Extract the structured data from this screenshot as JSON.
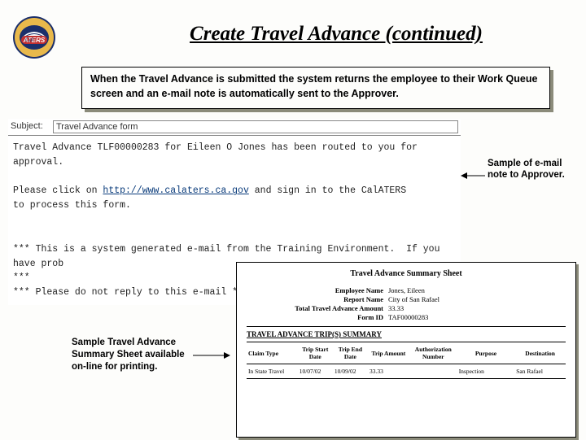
{
  "title": "Create Travel Advance (continued)",
  "banner": "When the Travel Advance is submitted the system returns the employee to their Work Queue screen and an e-mail note is automatically sent to the Approver.",
  "annot1": "Sample of e-mail note to Approver.",
  "annot2": "Sample Travel Advance Summary Sheet available on-line for printing.",
  "email": {
    "subject_label": "Subject:",
    "subject_value": "Travel Advance form",
    "line1a": "Travel Advance ",
    "line1b": "TLF00000283",
    "line1c": " for Eileen O Jones has been routed to you for approval.",
    "line2a": "Please click on ",
    "link": "http://www.calaters.ca.gov",
    "line2b": " and sign in to the CalATERS",
    "line3": "to process this form.",
    "foot1": "*** This is a system generated e-mail from the Training Environment.  If you have prob",
    "foot2": "***",
    "foot3": "*** Please do not reply to this e-mail ***"
  },
  "sheet": {
    "title": "Travel Advance Summary Sheet",
    "fields": {
      "employee_name_k": "Employee Name",
      "employee_name_v": "Jones, Eileen",
      "report_name_k": "Report Name",
      "report_name_v": "City of San Rafael",
      "amount_k": "Total Travel Advance Amount",
      "amount_v": "33.33",
      "formid_k": "Form ID",
      "formid_v": "TAF00000283"
    },
    "section": "TRAVEL ADVANCE TRIP(S) SUMMARY",
    "columns": [
      "Claim Type",
      "Trip Start Date",
      "Trip End Date",
      "Trip Amount",
      "Authorization Number",
      "Purpose",
      "Destination"
    ],
    "row": [
      "In State Travel",
      "10/07/02",
      "10/09/02",
      "33.33",
      "",
      "Inspection",
      "San Rafael"
    ]
  }
}
